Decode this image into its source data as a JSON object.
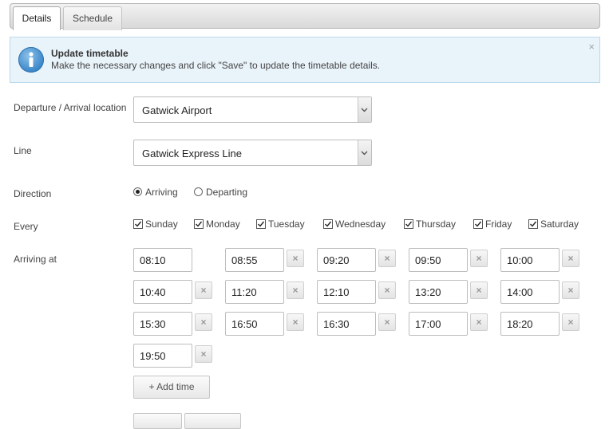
{
  "tabs": [
    {
      "label": "Details",
      "active": true
    },
    {
      "label": "Schedule",
      "active": false
    }
  ],
  "info": {
    "title": "Update timetable",
    "text": "Make the necessary changes and click \"Save\" to update the timetable details.",
    "close": "×"
  },
  "form": {
    "location": {
      "label": "Departure / Arrival location",
      "value": "Gatwick Airport"
    },
    "line": {
      "label": "Line",
      "value": "Gatwick Express Line"
    },
    "direction": {
      "label": "Direction",
      "options": [
        {
          "label": "Arriving",
          "selected": true
        },
        {
          "label": "Departing",
          "selected": false
        }
      ]
    },
    "every": {
      "label": "Every",
      "days": [
        {
          "label": "Sunday",
          "checked": true
        },
        {
          "label": "Monday",
          "checked": true
        },
        {
          "label": "Tuesday",
          "checked": true
        },
        {
          "label": "Wednesday",
          "checked": true
        },
        {
          "label": "Thursday",
          "checked": true
        },
        {
          "label": "Friday",
          "checked": true
        },
        {
          "label": "Saturday",
          "checked": true
        }
      ]
    },
    "times": {
      "label": "Arriving at",
      "values": [
        "08:10",
        "08:55",
        "09:20",
        "09:50",
        "10:00",
        "10:40",
        "11:20",
        "12:10",
        "13:20",
        "14:00",
        "15:30",
        "16:50",
        "16:30",
        "17:00",
        "18:20",
        "19:50"
      ],
      "remove_label": "×",
      "add_label": "+ Add time"
    }
  },
  "colors": {
    "info_bg": "#e9f3fa",
    "info_border": "#bcd9ec",
    "info_icon": "#3a86c8"
  }
}
